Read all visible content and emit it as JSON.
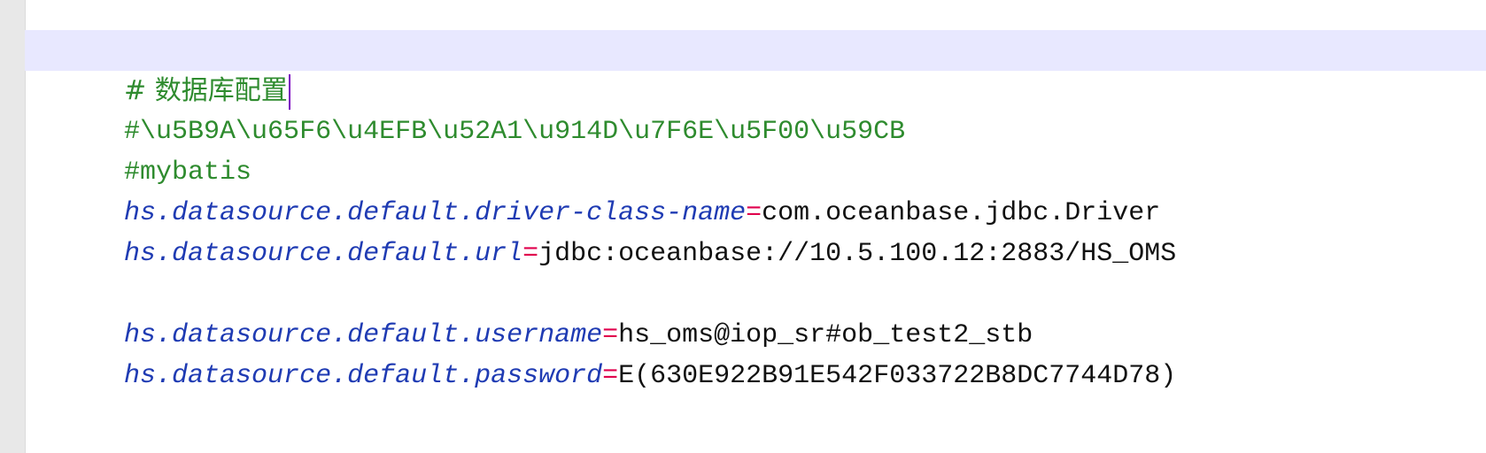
{
  "editor": {
    "lines": [
      {
        "type": "comment",
        "text": "# 数据库配置",
        "current": true
      },
      {
        "type": "comment",
        "text": "#\\u5B9A\\u65F6\\u4EFB\\u52A1\\u914D\\u7F6E\\u5F00\\u59CB"
      },
      {
        "type": "comment",
        "text": "#mybatis"
      },
      {
        "type": "property",
        "key": "hs.datasource.default.driver-class-name",
        "eq": "=",
        "value": "com.oceanbase.jdbc.Driver"
      },
      {
        "type": "property",
        "key": "hs.datasource.default.url",
        "eq": "=",
        "value": "jdbc:oceanbase://10.5.100.12:2883/HS_OMS"
      },
      {
        "type": "blank",
        "text": ""
      },
      {
        "type": "property",
        "key": "hs.datasource.default.username",
        "eq": "=",
        "value": "hs_oms@iop_sr#ob_test2_stb"
      },
      {
        "type": "property",
        "key": "hs.datasource.default.password",
        "eq": "=",
        "value": "E(630E922B91E542F033722B8DC7744D78)"
      }
    ]
  }
}
